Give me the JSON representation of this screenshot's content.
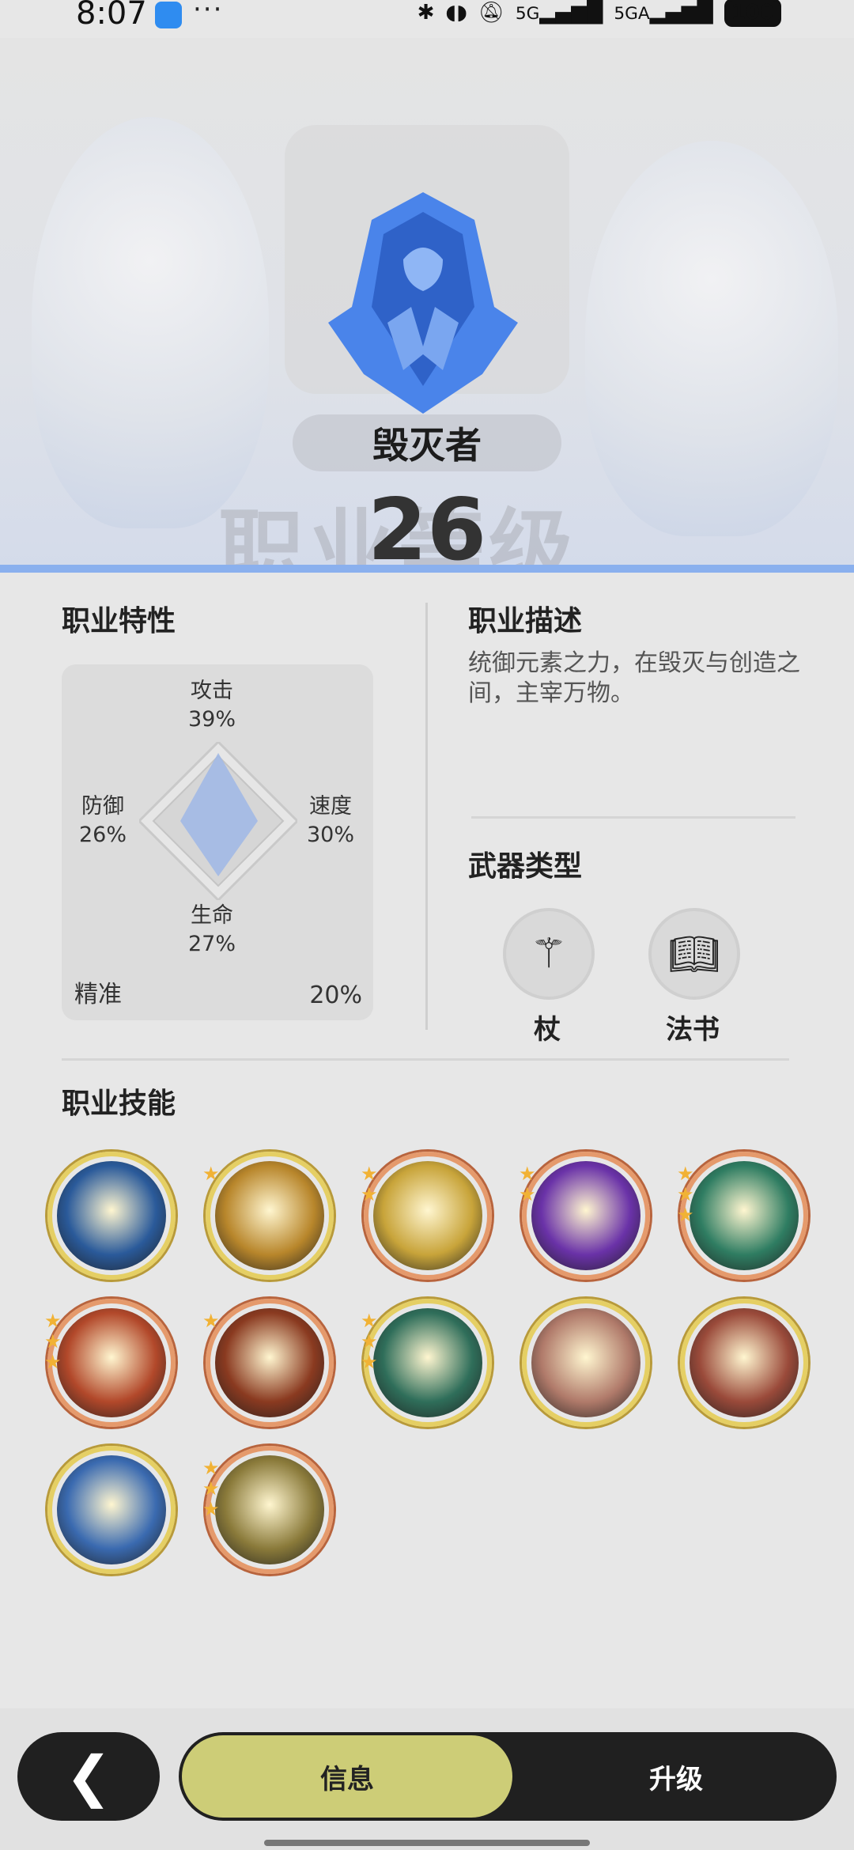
{
  "status_bar": {
    "time": "8:07",
    "more": "···",
    "icons": [
      "bluetooth-icon",
      "earbuds-icon",
      "mute-icon",
      "signal-5g-icon",
      "signal-5ga-icon"
    ],
    "network1": "5G",
    "network2": "5GA",
    "battery": "100"
  },
  "hero": {
    "class_name": "毁灭者",
    "level": "26",
    "watermark": "职业等级"
  },
  "traits": {
    "title": "职业特性",
    "attack_label": "攻击",
    "attack_value": "39%",
    "defense_label": "防御",
    "defense_value": "26%",
    "speed_label": "速度",
    "speed_value": "30%",
    "life_label": "生命",
    "life_value": "27%",
    "precision_label": "精准",
    "precision_value": "20%"
  },
  "description": {
    "title": "职业描述",
    "text": "统御元素之力，在毁灭与创造之间，主宰万物。"
  },
  "weapons": {
    "title": "武器类型",
    "items": [
      {
        "label": "杖",
        "icon": "staff-icon"
      },
      {
        "label": "法书",
        "icon": "book-icon"
      }
    ]
  },
  "skills": {
    "title": "职业技能",
    "items": [
      {
        "icon": "wave-skill-icon",
        "frame": "gold",
        "stars": 0,
        "color": "#2a5a9a"
      },
      {
        "icon": "lightning-strike-skill-icon",
        "frame": "gold",
        "stars": 1,
        "color": "#b8862b"
      },
      {
        "icon": "light-burst-skill-icon",
        "frame": "orange",
        "stars": 2,
        "color": "#c8a43a"
      },
      {
        "icon": "arcane-orb-skill-icon",
        "frame": "orange",
        "stars": 2,
        "color": "#6a32a8"
      },
      {
        "icon": "wind-vortex-skill-icon",
        "frame": "orange",
        "stars": 3,
        "color": "#2f7d62"
      },
      {
        "icon": "fire-explosion-skill-icon",
        "frame": "orange",
        "stars": 3,
        "color": "#b2482a"
      },
      {
        "icon": "flame-swirl-skill-icon",
        "frame": "orange",
        "stars": 1,
        "color": "#8a3a20"
      },
      {
        "icon": "crystal-shard-skill-icon",
        "frame": "gold",
        "stars": 3,
        "color": "#2f6e5a"
      },
      {
        "icon": "life-drain-skill-icon",
        "frame": "gold",
        "stars": 0,
        "color": "#b07a6a"
      },
      {
        "icon": "demon-mask-skill-icon",
        "frame": "gold",
        "stars": 0,
        "color": "#9a4a3a"
      },
      {
        "icon": "ice-crystal-skill-icon",
        "frame": "gold",
        "stars": 0,
        "color": "#3a6ab0"
      },
      {
        "icon": "shield-skill-icon",
        "frame": "orange",
        "stars": 3,
        "color": "#8a7a3a"
      }
    ]
  },
  "nav": {
    "back_icon": "chevron-left-icon",
    "back_glyph": "❮",
    "tab_info": "信息",
    "tab_upgrade": "升级"
  },
  "colors": {
    "accent_line": "#8ab0ee",
    "emblem_blue": "#3f7fe6",
    "active_tab": "#cdcd77"
  }
}
